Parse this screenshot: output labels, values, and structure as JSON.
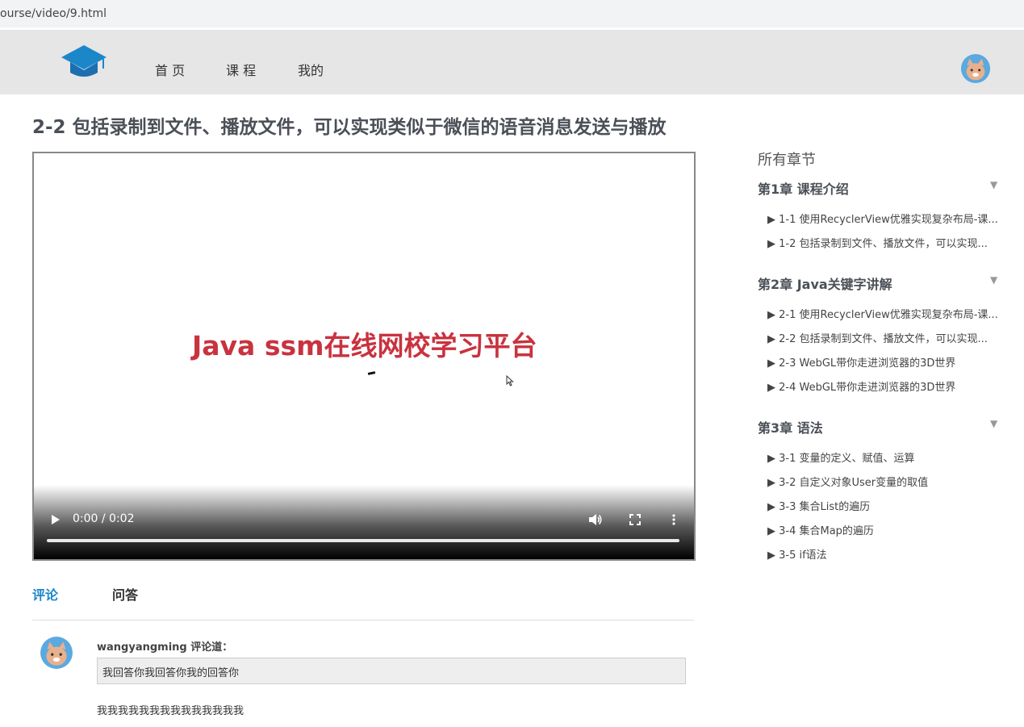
{
  "browser": {
    "url": "ourse/video/9.html"
  },
  "nav": {
    "items": [
      "首 页",
      "课 程",
      "我的"
    ]
  },
  "page_title": "2-2 包括录制到文件、播放文件，可以实现类似于微信的语音消息发送与播放",
  "video": {
    "overlay_text": "Java ssm在线网校学习平台",
    "time": "0:00 / 0:02",
    "progress": 0
  },
  "tabs": [
    "评论",
    "问答"
  ],
  "comment": {
    "author": "wangyangming 评论道：",
    "reply": "我回答你我回答你我的回答你",
    "text": "我我我我我我我我我我我我我我"
  },
  "sidebar": {
    "title": "所有章节",
    "chapters": [
      {
        "title": "第1章 课程介绍",
        "lessons": [
          "▶ 1-1 使用RecyclerView优雅实现复杂布局-课...",
          "▶ 1-2 包括录制到文件、播放文件，可以实现..."
        ]
      },
      {
        "title": "第2章 Java关键字讲解",
        "lessons": [
          "▶ 2-1 使用RecyclerView优雅实现复杂布局-课...",
          "▶ 2-2 包括录制到文件、播放文件，可以实现...",
          "▶ 2-3 WebGL带你走进浏览器的3D世界",
          "▶ 2-4 WebGL带你走进浏览器的3D世界"
        ]
      },
      {
        "title": "第3章 语法",
        "lessons": [
          "▶ 3-1 变量的定义、赋值、运算",
          "▶ 3-2 自定义对象User变量的取值",
          "▶ 3-3 集合List的遍历",
          "▶ 3-4 集合Map的遍历",
          "▶ 3-5 if语法"
        ]
      }
    ]
  },
  "colors": {
    "accent": "#1b87c9",
    "title_red": "#c9323f",
    "nav_bg": "#e6e6e6"
  }
}
